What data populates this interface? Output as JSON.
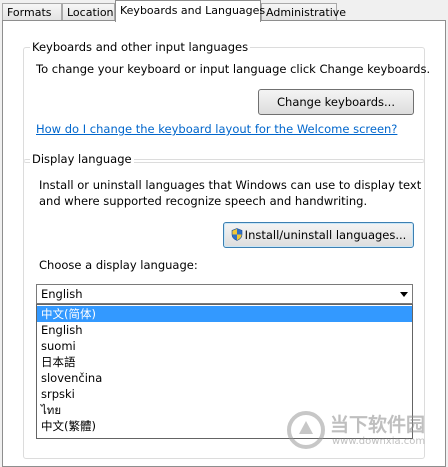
{
  "tabs": [
    {
      "label": "Formats"
    },
    {
      "label": "Location"
    },
    {
      "label": "Keyboards and Languages"
    },
    {
      "label": "Administrative"
    }
  ],
  "keyboards": {
    "title": "Keyboards and other input languages",
    "description": "To change your keyboard or input language click Change keyboards.",
    "change_button": "Change keyboards...",
    "help_link": "How do I change the keyboard layout for the Welcome screen?"
  },
  "display": {
    "title": "Display language",
    "desc_line1": "Install or uninstall languages that Windows can use to display text",
    "desc_line2": "and where supported recognize speech and handwriting.",
    "install_button": "Install/uninstall languages...",
    "choose_label": "Choose a display language:",
    "selected_value": "English",
    "options": [
      "中文(简体)",
      "English",
      "suomi",
      "日本語",
      "slovenčina",
      "srpski",
      "ไทย",
      "中文(繁體)"
    ]
  },
  "watermark": {
    "text": "当下软件园",
    "url": "www.downxia.com"
  },
  "colors": {
    "selection": "#3399ff",
    "link": "#0066cc"
  }
}
